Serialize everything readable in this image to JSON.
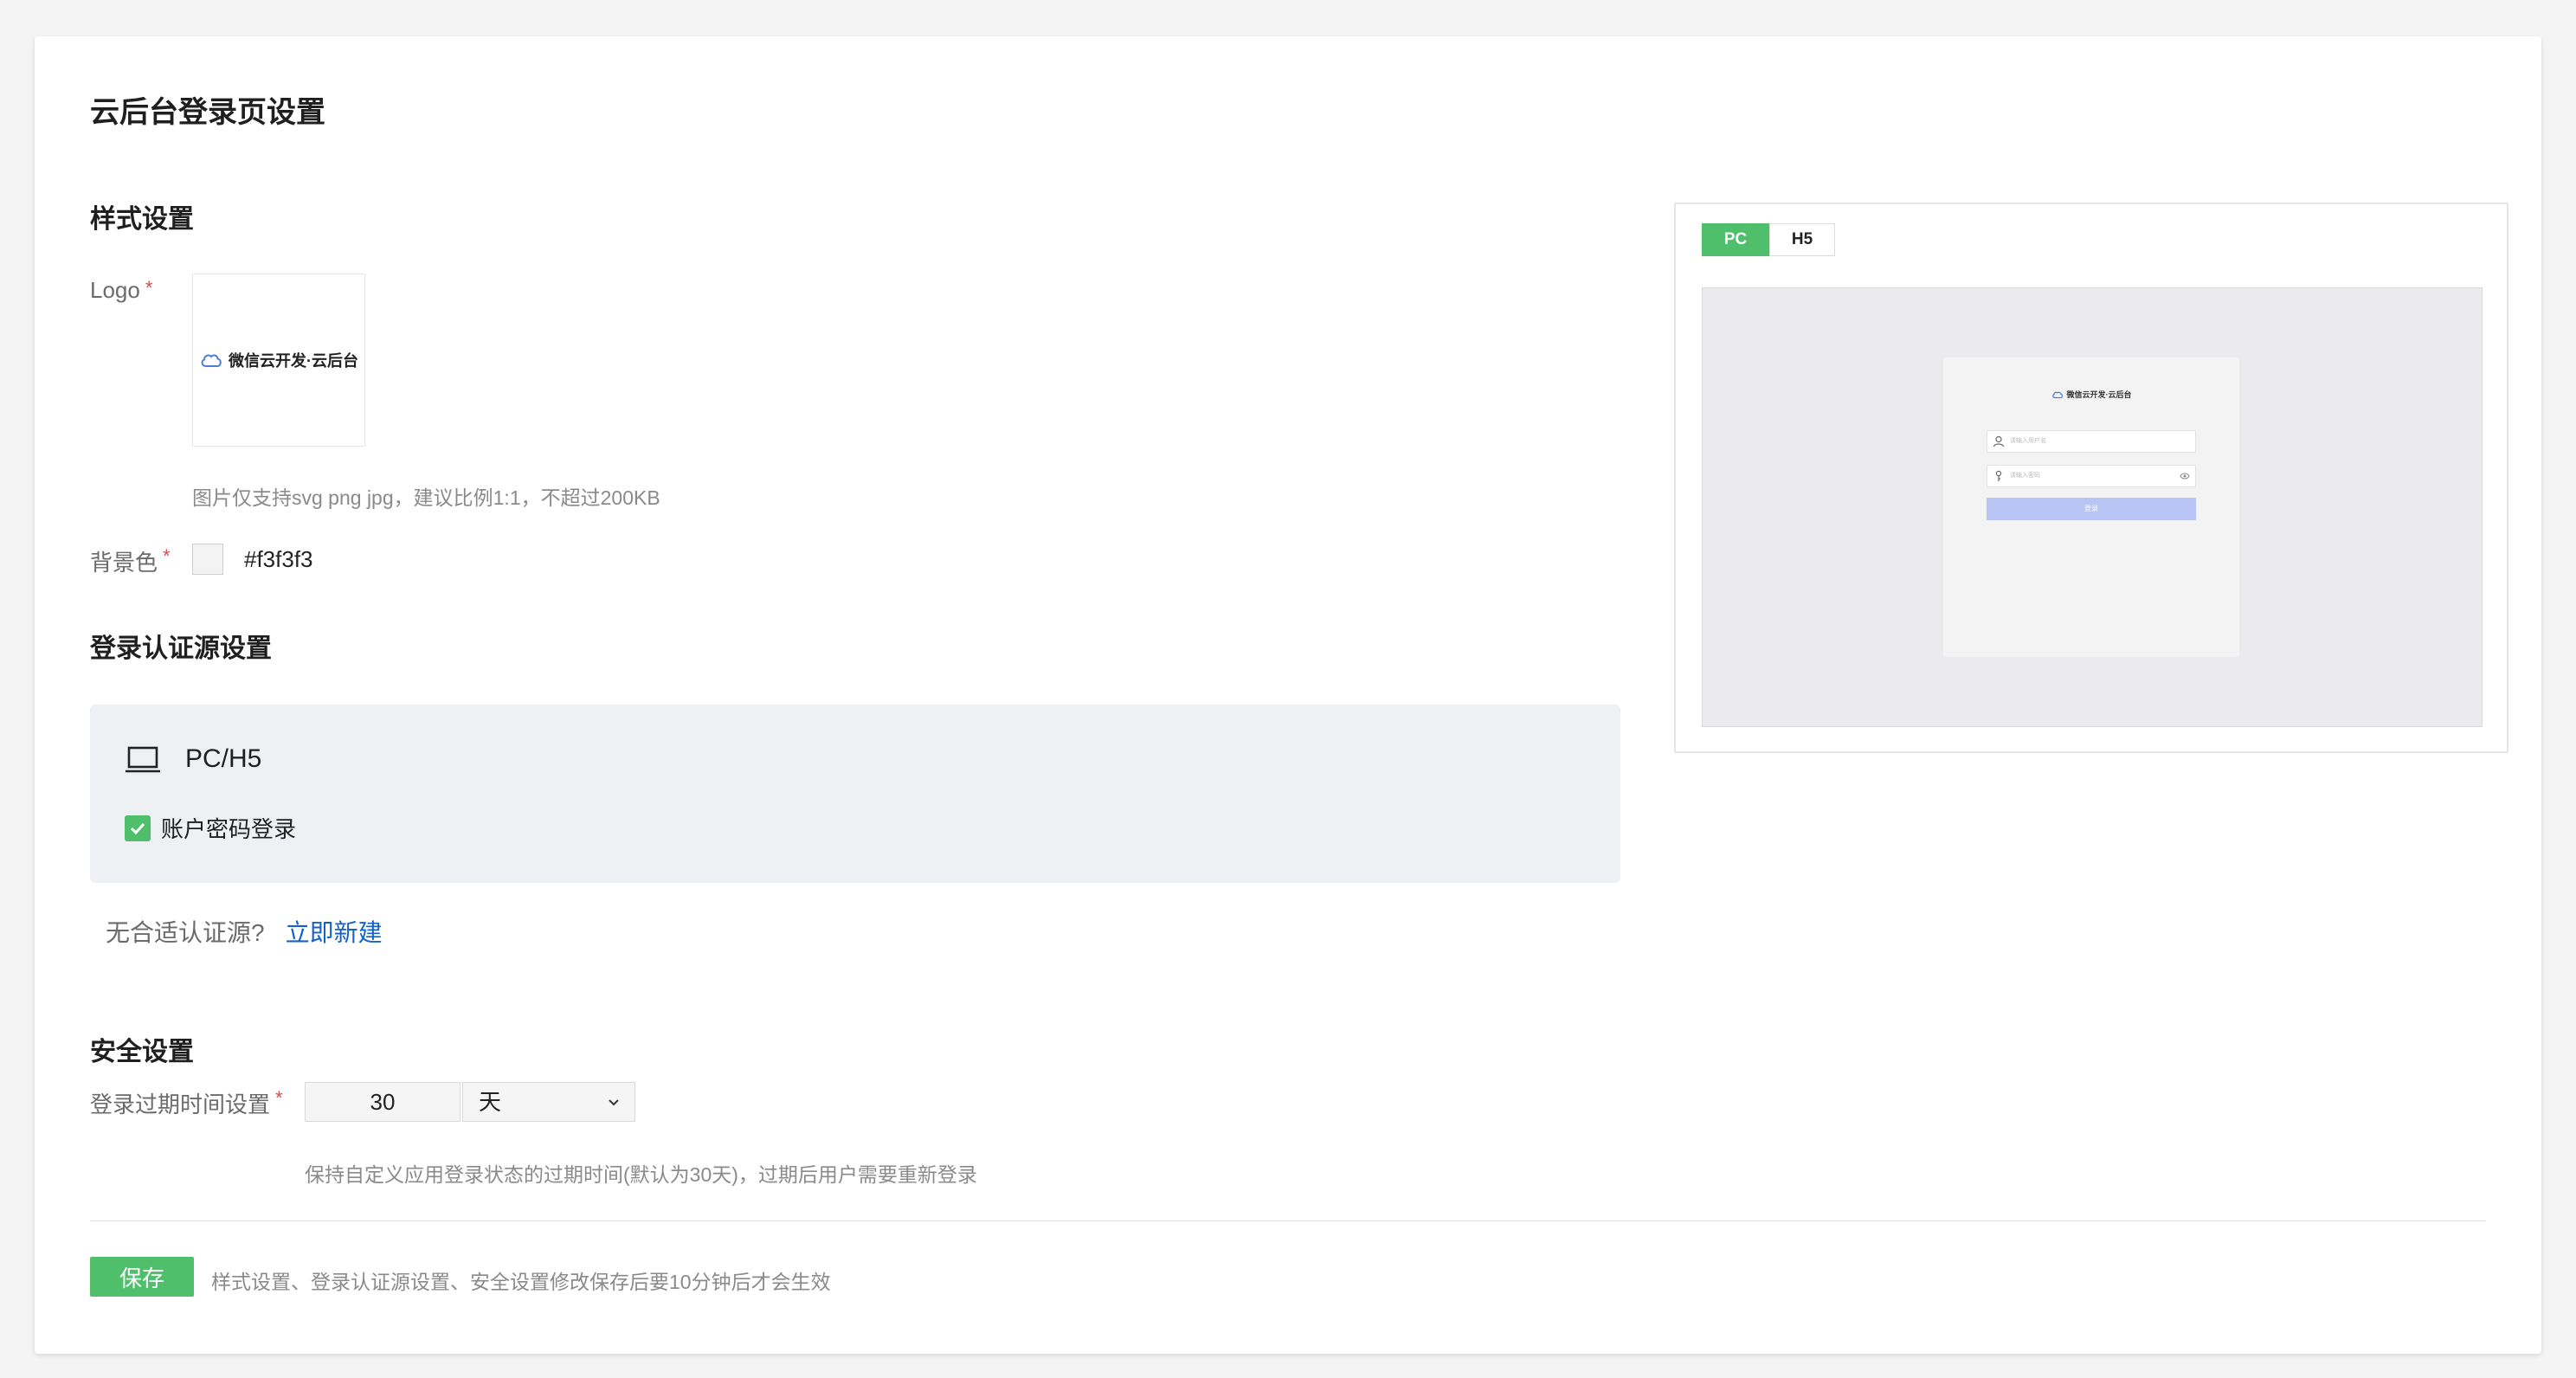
{
  "page": {
    "title": "云后台登录页设置"
  },
  "style_settings": {
    "title": "样式设置",
    "logo_label": "Logo",
    "logo_text": "微信云开发·云后台",
    "logo_hint": "图片仅支持svg png jpg，建议比例1:1，不超过200KB",
    "bg_label": "背景色",
    "bg_value": "#f3f3f3"
  },
  "auth_settings": {
    "title": "登录认证源设置",
    "panel_title": "PC/H5",
    "option_label": "账户密码登录",
    "option_checked": true,
    "no_source_text": "无合适认证源?",
    "create_link": "立即新建"
  },
  "security_settings": {
    "title": "安全设置",
    "expire_label": "登录过期时间设置",
    "expire_value": "30",
    "expire_unit": "天",
    "expire_hint": "保持自定义应用登录状态的过期时间(默认为30天)，过期后用户需要重新登录"
  },
  "footer": {
    "save_label": "保存",
    "save_hint": "样式设置、登录认证源设置、安全设置修改保存后要10分钟后才会生效"
  },
  "preview": {
    "tabs": [
      "PC",
      "H5"
    ],
    "active_tab": "PC",
    "logo_text": "微信云开发·云后台",
    "username_placeholder": "请输入用户名",
    "password_placeholder": "请输入密码",
    "login_label": "登录"
  },
  "colors": {
    "accent": "#4fbf6c",
    "link": "#1561c7",
    "required": "#e54545",
    "preview_button": "#b8c4f4"
  },
  "icons": [
    "cloud-icon",
    "laptop-icon",
    "check-icon",
    "chevron-down-icon",
    "user-icon",
    "key-icon",
    "eye-icon"
  ]
}
